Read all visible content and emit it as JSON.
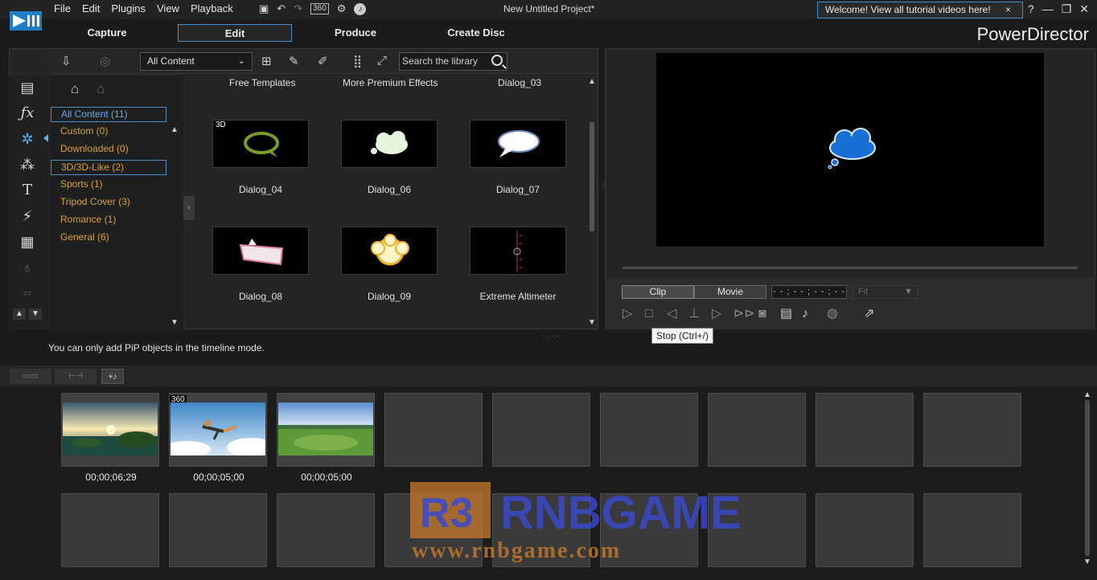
{
  "menu": {
    "items": [
      "File",
      "Edit",
      "Plugins",
      "View",
      "Playback"
    ],
    "resolution_badge": "360",
    "project_title": "New Untitled Project*",
    "welcome_text": "Welcome! View all tutorial videos here!",
    "welcome_close": "×",
    "help": "?"
  },
  "tabs": [
    "Capture",
    "Edit",
    "Produce",
    "Create Disc"
  ],
  "brand": "PowerDirector",
  "library": {
    "filter_value": "All Content",
    "search_placeholder": "Search the library",
    "categories": [
      {
        "label": "All Content (11)"
      },
      {
        "label": "Custom  (0)"
      },
      {
        "label": "Downloaded  (0)"
      },
      {
        "label": "3D/3D-Like  (2)"
      },
      {
        "label": "Sports  (1)"
      },
      {
        "label": "Tripod Cover  (3)"
      },
      {
        "label": "Romance  (1)"
      },
      {
        "label": "General  (6)"
      }
    ],
    "top_row": [
      "Free Templates",
      "More Premium Effects",
      "Dialog_03"
    ],
    "items": [
      {
        "label": "Dialog_04",
        "badge": "3D"
      },
      {
        "label": "Dialog_06"
      },
      {
        "label": "Dialog_07"
      },
      {
        "label": "Dialog_08"
      },
      {
        "label": "Dialog_09"
      },
      {
        "label": "Extreme Altimeter"
      }
    ]
  },
  "preview": {
    "clip_label": "Clip",
    "movie_label": "Movie",
    "timecode": "- - ; - - ; - - ; - -",
    "fit_label": "Fit",
    "tooltip": "Stop (Ctrl+/)"
  },
  "status_message": "You can only add PiP objects in the timeline mode.",
  "storyboard": {
    "clips": [
      {
        "duration": "00;00;06;29"
      },
      {
        "duration": "00;00;05;00",
        "badge": "360"
      },
      {
        "duration": "00;00;05;00"
      }
    ]
  },
  "watermark": {
    "logo": "R3",
    "name": "RNBGAME",
    "url": "www.rnbgame.com"
  },
  "colors": {
    "accent": "#4a90c8",
    "category": "#d6a13a",
    "selected_category": "#5ab0ef",
    "bubble": "#1a6fd6"
  }
}
